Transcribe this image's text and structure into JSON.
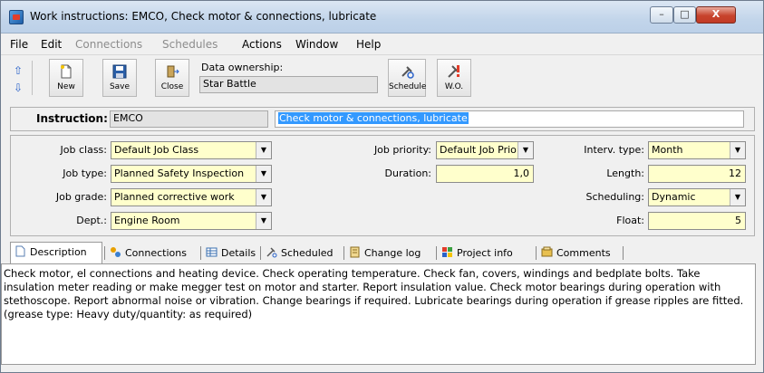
{
  "window": {
    "title": "Work instructions: EMCO, Check motor & connections, lubricate",
    "controls": {
      "minimize": "–",
      "maximize": "□",
      "close": "X"
    }
  },
  "menu": {
    "items": [
      {
        "label": "File",
        "enabled": true
      },
      {
        "label": "Edit",
        "enabled": true
      },
      {
        "label": "Connections",
        "enabled": false
      },
      {
        "label": "Schedules",
        "enabled": false
      },
      {
        "label": "Actions",
        "enabled": true
      },
      {
        "label": "Window",
        "enabled": true
      },
      {
        "label": "Help",
        "enabled": true
      }
    ]
  },
  "toolbar": {
    "up_icon": "⇧",
    "down_icon": "⇩",
    "new_label": "New",
    "save_label": "Save",
    "close_label": "Close",
    "ownership_label": "Data ownership:",
    "ownership_value": "Star Battle",
    "schedule_label": "Schedule",
    "wo_label": "W.O."
  },
  "instruction": {
    "label": "Instruction:",
    "code": "EMCO",
    "title": "Check motor & connections, lubricate"
  },
  "fields": {
    "job_class": {
      "label": "Job class:",
      "value": "Default Job Class"
    },
    "job_type": {
      "label": "Job type:",
      "value": "Planned Safety Inspection"
    },
    "job_grade": {
      "label": "Job grade:",
      "value": "Planned corrective work"
    },
    "dept": {
      "label": "Dept.:",
      "value": "Engine Room"
    },
    "job_priority": {
      "label": "Job priority:",
      "value": "Default Job Prio"
    },
    "duration": {
      "label": "Duration:",
      "value": "1,0"
    },
    "interv_type": {
      "label": "Interv. type:",
      "value": "Month"
    },
    "length": {
      "label": "Length:",
      "value": "12"
    },
    "scheduling": {
      "label": "Scheduling:",
      "value": "Dynamic"
    },
    "float": {
      "label": "Float:",
      "value": "5"
    },
    "dropdown_glyph": "▼"
  },
  "tabs": [
    {
      "label": "Description",
      "icon": "document-icon",
      "active": true
    },
    {
      "label": "Connections",
      "icon": "connections-icon",
      "active": false
    },
    {
      "label": "Details",
      "icon": "table-icon",
      "active": false
    },
    {
      "label": "Scheduled",
      "icon": "schedule-icon",
      "active": false
    },
    {
      "label": "Change log",
      "icon": "changelog-icon",
      "active": false
    },
    {
      "label": "Project info",
      "icon": "project-icon",
      "active": false
    },
    {
      "label": "Comments",
      "icon": "comments-icon",
      "active": false
    }
  ],
  "description": "Check motor, el connections and heating device. Check operating temperature. Check fan, covers, windings and bedplate bolts. Take insulation meter reading or make megger test on motor and starter. Report insulation value. Check motor bearings during operation with stethoscope. Report abnormal noise or vibration. Change bearings if required. Lubricate bearings during operation if grease ripples are fitted. (grease type: Heavy duty/quantity: as required)",
  "colors": {
    "mandatory_field_bg": "#ffffcc",
    "selection_bg": "#3399ff",
    "close_button": "#c7432c"
  }
}
